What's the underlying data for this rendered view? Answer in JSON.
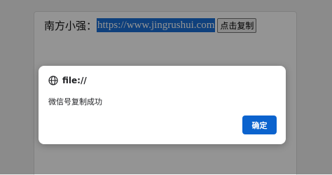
{
  "page": {
    "label": "南方小强：",
    "url_text": "https://www.jingrushui.com",
    "copy_button": "点击复制"
  },
  "dialog": {
    "origin": "file://",
    "message": "微信号复制成功",
    "ok_button": "确定"
  },
  "colors": {
    "selection": "#1a6fd6",
    "ok_button": "#0b63ce"
  },
  "icons": {
    "dialog_origin": "globe-icon"
  }
}
